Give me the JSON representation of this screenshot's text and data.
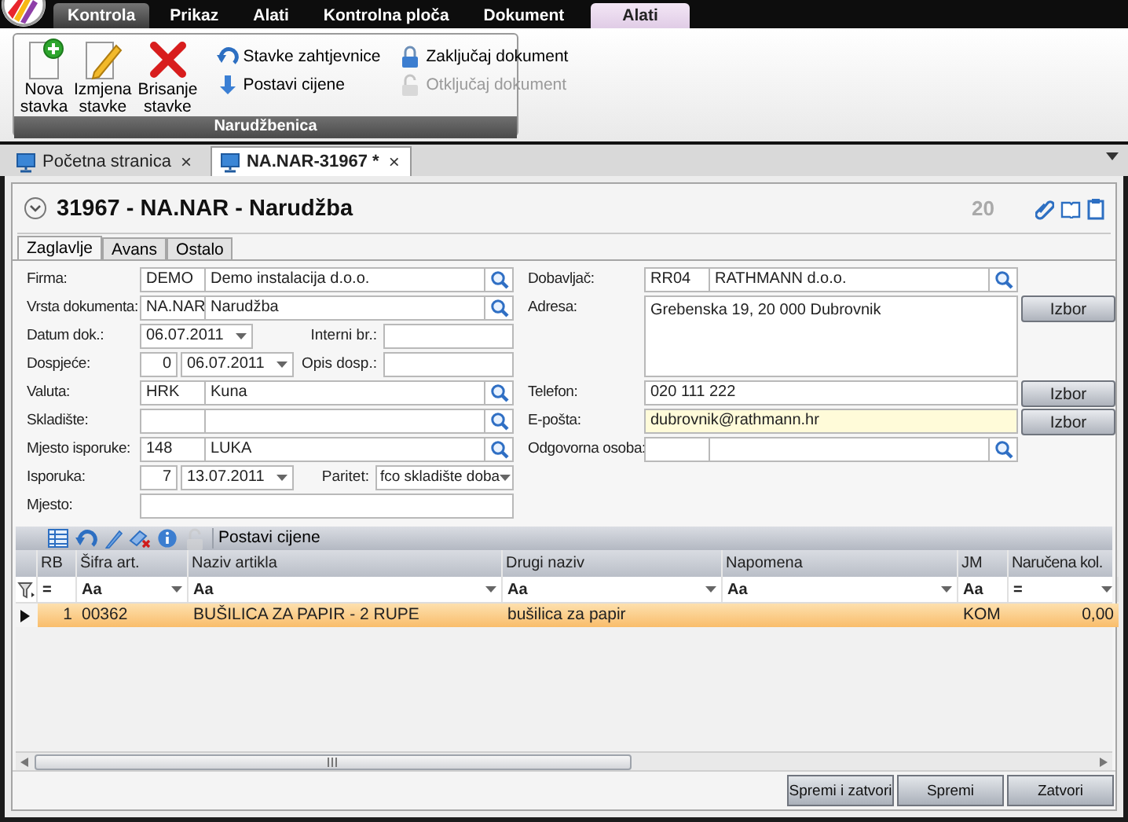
{
  "ribbon_tabs": [
    {
      "label": "Kontrola",
      "selected": true,
      "kind": "normal"
    },
    {
      "label": "Prikaz",
      "selected": false,
      "kind": "normal"
    },
    {
      "label": "Alati",
      "selected": false,
      "kind": "normal"
    },
    {
      "label": "Kontrolna ploča",
      "selected": false,
      "kind": "normal"
    },
    {
      "label": "Dokument",
      "selected": false,
      "kind": "normal"
    },
    {
      "label": "Alati",
      "selected": false,
      "kind": "contextual"
    }
  ],
  "ribbon_group": {
    "title": "Narudžbenica",
    "large_buttons": [
      {
        "label": "Nova stavka"
      },
      {
        "label": "Izmjena stavke"
      },
      {
        "label": "Brisanje stavke"
      }
    ],
    "small_buttons": [
      {
        "label": "Stavke zahtjevnice",
        "disabled": false
      },
      {
        "label": "Postavi cijene",
        "disabled": false
      },
      {
        "label": "Zaključaj dokument",
        "disabled": false
      },
      {
        "label": "Otključaj dokument",
        "disabled": true
      }
    ]
  },
  "document_tabs": [
    {
      "label": "Početna stranica",
      "close": "×",
      "selected": false
    },
    {
      "label": "NA.NAR-31967 *",
      "close": "×",
      "selected": true
    }
  ],
  "document": {
    "title": "31967 - NA.NAR - Narudžba",
    "number": "20"
  },
  "form_tabs": [
    {
      "label": "Zaglavlje",
      "selected": true
    },
    {
      "label": "Avans",
      "selected": false
    },
    {
      "label": "Ostalo",
      "selected": false
    }
  ],
  "left_fields": [
    {
      "label": "Firma:",
      "kind": "lookup",
      "code": "DEMO",
      "value": "Demo instalacija d.o.o."
    },
    {
      "label": "Vrsta dokumenta:",
      "kind": "lookup",
      "code": "NA.NAR",
      "value": "Narudžba"
    },
    {
      "label": "Datum dok.:",
      "kind": "date",
      "date": "06.07.2011",
      "extra": {
        "label": "Interni br.:",
        "kind": "text"
      }
    },
    {
      "label": "Dospjeće:",
      "kind": "date",
      "days": "0",
      "date": "06.07.2011",
      "extra": {
        "label": "Opis dosp.:",
        "kind": "text"
      }
    },
    {
      "label": "Valuta:",
      "kind": "lookup",
      "code": "HRK",
      "value": "Kuna"
    },
    {
      "label": "Skladište:",
      "kind": "lookup"
    },
    {
      "label": "Mjesto isporuke:",
      "kind": "lookup",
      "code": "148",
      "value": "LUKA"
    },
    {
      "label": "Isporuka:",
      "kind": "date",
      "days": "7",
      "date": "13.07.2011",
      "extra": {
        "label": "Paritet:",
        "kind": "select",
        "value": "fco skladište doba"
      }
    },
    {
      "label": "Mjesto:",
      "kind": "text"
    }
  ],
  "right_fields": [
    {
      "label": "Dobavljač:",
      "kind": "lookup",
      "code": "RR04",
      "value": "RATHMANN d.o.o.",
      "focused": false
    },
    {
      "label": "Adresa:",
      "kind": "textarea",
      "value": "Grebenska 19, 20 000 Dubrovnik",
      "button": "Izbor",
      "focused": false
    },
    {
      "label": "Telefon:",
      "kind": "text",
      "value": "020 111 222",
      "button": "Izbor",
      "focused": false
    },
    {
      "label": "E-pošta:",
      "kind": "text",
      "value": "dubrovnik@rathmann.hr",
      "button": "Izbor",
      "focused": true
    },
    {
      "label": "Odgovorna osoba:",
      "kind": "lookup",
      "focused": false
    }
  ],
  "grid_toolbar": {
    "icons": [
      {
        "disabled": false
      },
      {
        "disabled": false
      },
      {
        "disabled": false
      },
      {
        "disabled": false
      },
      {
        "disabled": false
      },
      {
        "disabled": true
      }
    ],
    "button": "Postavi cijene"
  },
  "grid": {
    "columns": [
      {
        "title": "RB",
        "filter": "=",
        "dropdown": false
      },
      {
        "title": "Šifra art.",
        "filter": "Aa",
        "dropdown": true
      },
      {
        "title": "Naziv artikla",
        "filter": "Aa",
        "dropdown": true
      },
      {
        "title": "Drugi naziv",
        "filter": "Aa",
        "dropdown": true
      },
      {
        "title": "Napomena",
        "filter": "Aa",
        "dropdown": true
      },
      {
        "title": "JM",
        "filter": "Aa",
        "dropdown": false
      },
      {
        "title": "Naručena kol.",
        "filter": "=",
        "dropdown": true
      }
    ],
    "rows": [
      {
        "selected": true,
        "rb": "1",
        "sifra": "00362",
        "naziv": "BUŠILICA ZA PAPIR - 2 RUPE",
        "drugi_naziv": "bušilica za papir",
        "jm": "KOM",
        "kolicina": "0,00"
      }
    ]
  },
  "footer_buttons": [
    "Spremi i zatvori",
    "Spremi",
    "Zatvori"
  ]
}
